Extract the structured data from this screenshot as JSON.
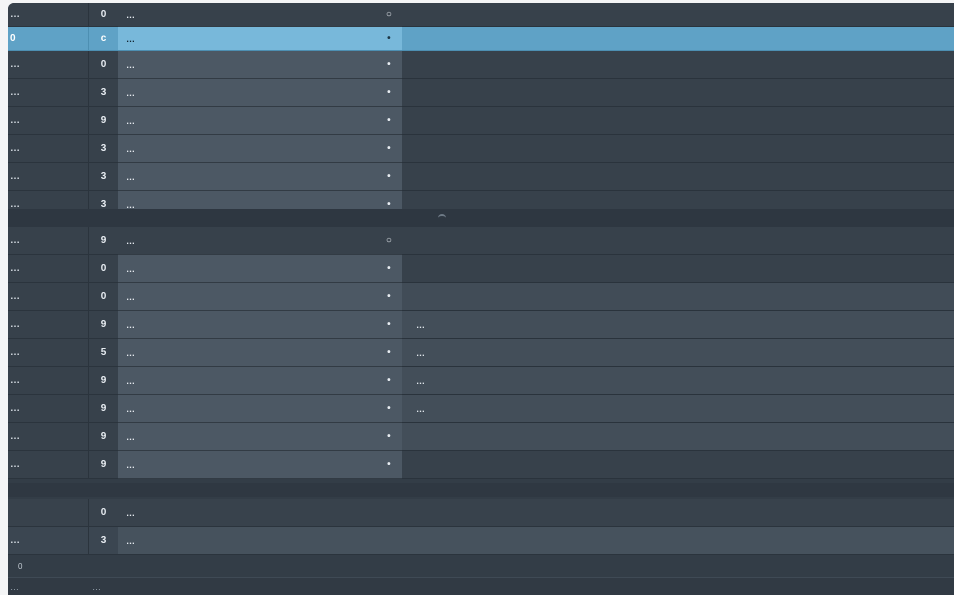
{
  "window": {
    "watermark": "…"
  },
  "group_a": {
    "rows": [
      {
        "left": "…",
        "num": "0",
        "label": "…",
        "marker": "○",
        "extra": ""
      },
      {
        "left": "0",
        "num": "c",
        "label": "…",
        "marker": "•",
        "extra": "",
        "selected": true
      },
      {
        "left": "…",
        "num": "0",
        "label": "…",
        "marker": "•",
        "extra": ""
      },
      {
        "left": "…",
        "num": "3",
        "label": "…",
        "marker": "•",
        "extra": ""
      },
      {
        "left": "…",
        "num": "9",
        "label": "…",
        "marker": "•",
        "extra": ""
      },
      {
        "left": "…",
        "num": "3",
        "label": "…",
        "marker": "•",
        "extra": ""
      },
      {
        "left": "…",
        "num": "3",
        "label": "…",
        "marker": "•",
        "extra": ""
      },
      {
        "left": "…",
        "num": "3",
        "label": "…",
        "marker": "•",
        "extra": ""
      }
    ]
  },
  "group_b": {
    "rows": [
      {
        "left": "…",
        "num": "9",
        "label": "…",
        "marker": "○",
        "extra": ""
      },
      {
        "left": "…",
        "num": "0",
        "label": "…",
        "marker": "•",
        "extra": ""
      },
      {
        "left": "…",
        "num": "0",
        "label": "…",
        "marker": "•",
        "extra": ""
      },
      {
        "left": "…",
        "num": "9",
        "label": "…",
        "marker": "•",
        "extra": "…"
      },
      {
        "left": "…",
        "num": "5",
        "label": "…",
        "marker": "•",
        "extra": "…"
      },
      {
        "left": "…",
        "num": "9",
        "label": "…",
        "marker": "•",
        "extra": "…"
      },
      {
        "left": "…",
        "num": "9",
        "label": "…",
        "marker": "•",
        "extra": "…"
      },
      {
        "left": "…",
        "num": "9",
        "label": "…",
        "marker": "•",
        "extra": ""
      },
      {
        "left": "…",
        "num": "9",
        "label": "…",
        "marker": "•",
        "extra": ""
      }
    ]
  },
  "footer": {
    "rows": [
      {
        "left": "",
        "num": "0",
        "label": "…"
      },
      {
        "left": "…",
        "num": "3",
        "label": "…"
      }
    ],
    "indicator": "0"
  },
  "status": {
    "left": "…",
    "right": "…"
  }
}
